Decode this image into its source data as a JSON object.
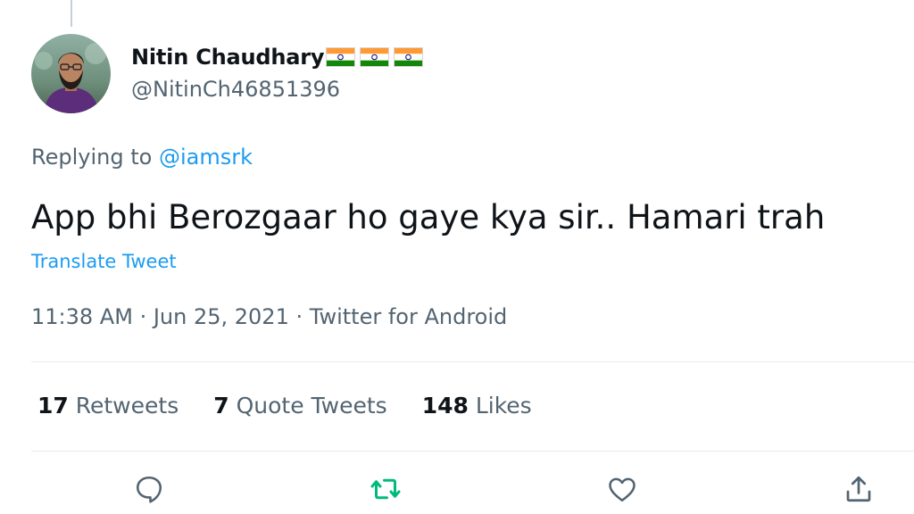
{
  "author": {
    "display_name": "Nitin Chaudhary",
    "flag_count": 3,
    "handle": "@NitinCh46851396"
  },
  "reply": {
    "prefix": "Replying to",
    "mention": "@iamsrk"
  },
  "tweet": {
    "text": "App bhi Berozgaar ho gaye kya sir.. Hamari trah",
    "translate_label": "Translate Tweet",
    "time": "11:38 AM",
    "date": "Jun 25, 2021",
    "source": "Twitter for Android",
    "separator": "·"
  },
  "stats": {
    "retweets": {
      "count": "17",
      "label": "Retweets"
    },
    "quote_tweets": {
      "count": "7",
      "label": "Quote Tweets"
    },
    "likes": {
      "count": "148",
      "label": "Likes"
    }
  },
  "actions": [
    {
      "icon": "reply-icon",
      "color": "#536471"
    },
    {
      "icon": "retweet-icon",
      "color": "#00ba7c"
    },
    {
      "icon": "heart-icon",
      "color": "#536471"
    },
    {
      "icon": "share-icon",
      "color": "#536471"
    }
  ],
  "colors": {
    "accent_blue": "#1d9bf0",
    "retweet_green": "#00ba7c",
    "secondary_text": "#536471",
    "primary_text": "#0f1419"
  }
}
